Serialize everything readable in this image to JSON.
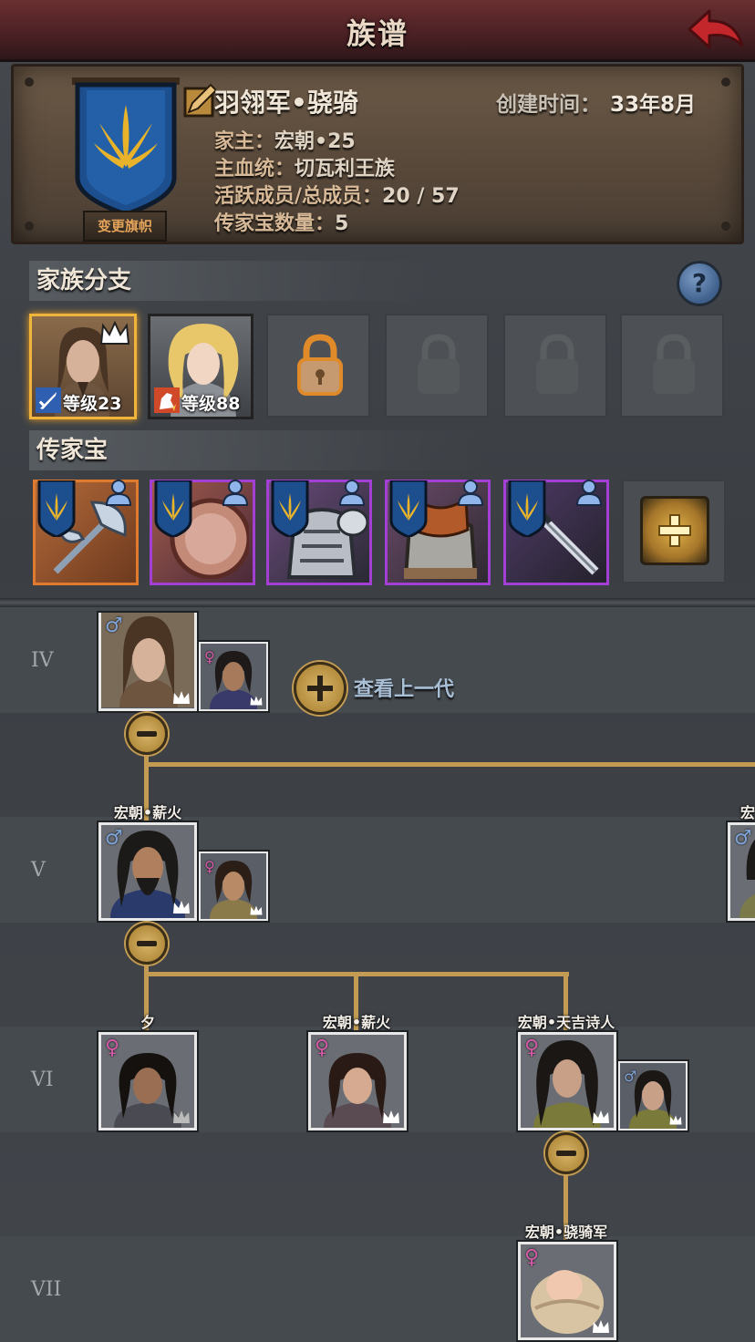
{
  "header": {
    "title": "族谱",
    "back_icon": "back-arrow-icon"
  },
  "family": {
    "name": "羽翎军•骁骑",
    "created_label": "创建时间：",
    "created_value": "33年8月",
    "change_flag_label": "变更旗帜",
    "lines": [
      {
        "key": "家主：",
        "value": "宏朝•25"
      },
      {
        "key": "主血统：",
        "value": "切瓦利王族"
      },
      {
        "key": "活跃成员/总成员：",
        "value": "20 / 57"
      },
      {
        "key": "传家宝数量：",
        "value": "5"
      }
    ]
  },
  "branches": {
    "title": "家族分支",
    "help_label": "?",
    "members": [
      {
        "level": "等级23",
        "badge": "sword-icon",
        "crowned": true
      },
      {
        "level": "等级88",
        "badge": "horse-icon",
        "crowned": false
      }
    ],
    "locked_slots": 4
  },
  "heirlooms": {
    "title": "传家宝",
    "items": [
      {
        "name": "axe",
        "rarity": "orange"
      },
      {
        "name": "shield",
        "rarity": "purple"
      },
      {
        "name": "armor",
        "rarity": "purple"
      },
      {
        "name": "fur-armor",
        "rarity": "purple"
      },
      {
        "name": "sword",
        "rarity": "purple"
      }
    ],
    "add_label": "+"
  },
  "tree": {
    "view_prev_label": "查看上一代",
    "generations": [
      "IV",
      "V",
      "VI",
      "VII"
    ],
    "names": {
      "v_main": "宏朝•薪火",
      "v_right": "宏",
      "vi_1": "夕",
      "vi_2": "宏朝•薪火",
      "vi_3": "宏朝•天吉诗人",
      "vii_1": "宏朝•骁骑军"
    }
  },
  "colors": {
    "accent": "#c39b52",
    "female": "#d45aa8",
    "male": "#7fa3d6",
    "orange_rarity": "#e07a2e",
    "purple_rarity": "#a43fd6"
  }
}
